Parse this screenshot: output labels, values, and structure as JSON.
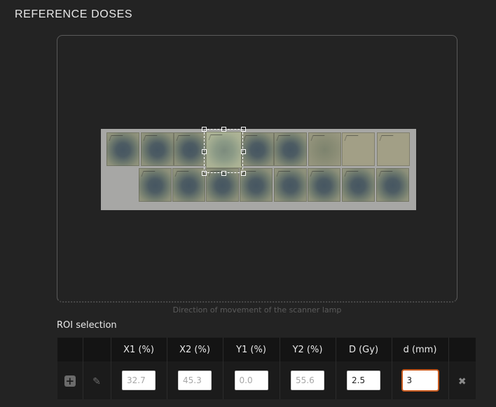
{
  "section": {
    "title": "REFERENCE DOSES"
  },
  "viewer": {
    "lamp_caption": "Direction of movement of the scanner lamp"
  },
  "roi": {
    "title": "ROI selection",
    "headers": [
      "",
      "",
      "X1 (%)",
      "X2 (%)",
      "Y1 (%)",
      "Y2 (%)",
      "D (Gy)",
      "d (mm)",
      ""
    ],
    "row": {
      "x1": "32.7",
      "x2": "45.3",
      "y1": "0.0",
      "y2": "55.6",
      "dose": "2.5",
      "depth": "3"
    }
  },
  "icons": {
    "add": "add-icon",
    "edit": "pencil-icon",
    "remove": "close-icon"
  },
  "colors": {
    "focus_border": "#c85a1e",
    "background": "#232323"
  }
}
